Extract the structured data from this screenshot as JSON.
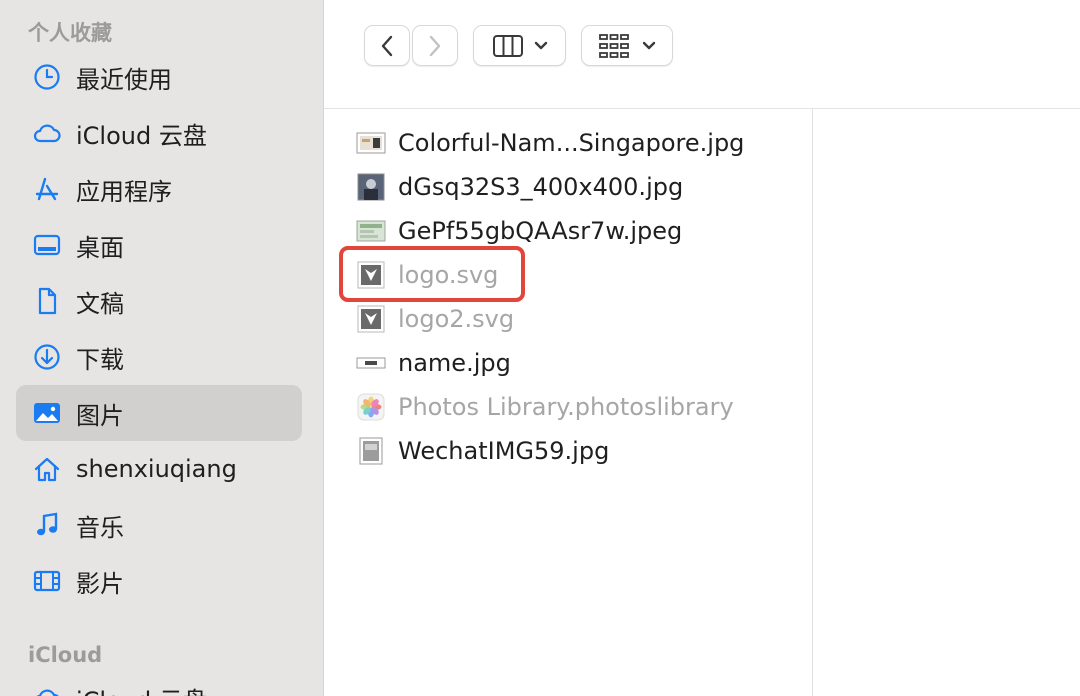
{
  "sidebar": {
    "favorites_header": "个人收藏",
    "items": [
      {
        "label": "最近使用",
        "icon": "clock-icon"
      },
      {
        "label": "iCloud 云盘",
        "icon": "cloud-icon"
      },
      {
        "label": "应用程序",
        "icon": "app-store-icon"
      },
      {
        "label": "桌面",
        "icon": "desktop-icon"
      },
      {
        "label": "文稿",
        "icon": "document-icon"
      },
      {
        "label": "下载",
        "icon": "download-icon"
      },
      {
        "label": "图片",
        "icon": "photo-icon",
        "selected": true
      },
      {
        "label": "shenxiuqiang",
        "icon": "home-icon"
      },
      {
        "label": "音乐",
        "icon": "music-icon"
      },
      {
        "label": "影片",
        "icon": "film-icon"
      }
    ],
    "icloud_header": "iCloud",
    "icloud_items": [
      {
        "label": "iCloud 云盘",
        "icon": "cloud-icon"
      }
    ]
  },
  "toolbar": {
    "back": "chevron-left-icon",
    "forward": "chevron-right-icon",
    "view_mode": "column-view-icon",
    "group_mode": "grid-group-icon"
  },
  "files": [
    {
      "name": "Colorful-Nam...Singapore.jpg",
      "dimmed": false,
      "thumb": "image-thumbnail"
    },
    {
      "name": "dGsq32S3_400x400.jpg",
      "dimmed": false,
      "thumb": "image-thumbnail"
    },
    {
      "name": "GePf55gbQAAsr7w.jpeg",
      "dimmed": false,
      "thumb": "image-thumbnail"
    },
    {
      "name": "logo.svg",
      "dimmed": true,
      "thumb": "svg-thumbnail"
    },
    {
      "name": "logo2.svg",
      "dimmed": true,
      "thumb": "svg-thumbnail"
    },
    {
      "name": "name.jpg",
      "dimmed": false,
      "thumb": "image-thumbnail"
    },
    {
      "name": "Photos Library.photoslibrary",
      "dimmed": true,
      "thumb": "photos-library-icon"
    },
    {
      "name": "WechatIMG59.jpg",
      "dimmed": false,
      "thumb": "image-thumbnail"
    }
  ],
  "colors": {
    "accent": "#1a7cf0",
    "highlight": "#e2463b",
    "sidebar_bg": "#e6e5e4",
    "selected_bg": "#d1d0cf"
  }
}
